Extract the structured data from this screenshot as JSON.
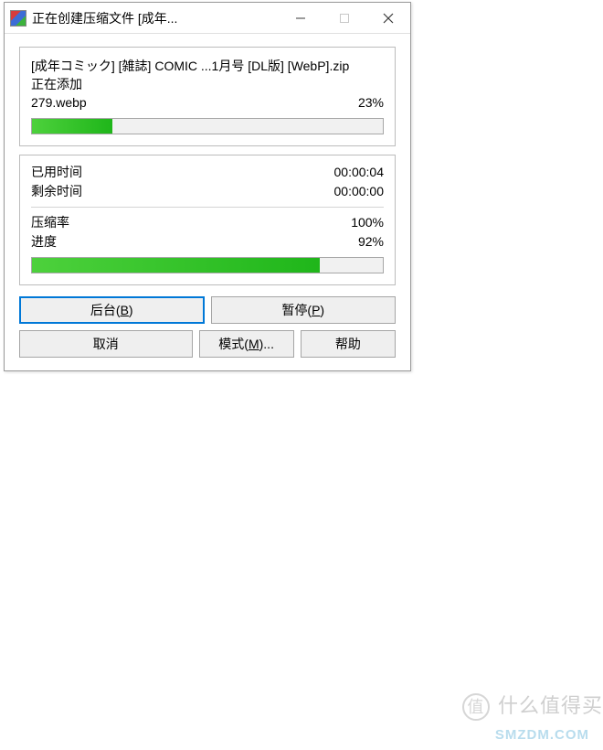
{
  "titlebar": {
    "title": "正在创建压缩文件 [成年..."
  },
  "file": {
    "name": "[成年コミック] [雑誌] COMIC ...1月号 [DL版] [WebP].zip",
    "status": "正在添加",
    "current_file": "279.webp",
    "file_percent": "23%",
    "file_progress": 23
  },
  "stats": {
    "elapsed_label": "已用时间",
    "elapsed_value": "00:00:04",
    "remaining_label": "剩余时间",
    "remaining_value": "00:00:00",
    "ratio_label": "压缩率",
    "ratio_value": "100%",
    "progress_label": "进度",
    "progress_value": "92%",
    "overall_progress": 82
  },
  "buttons": {
    "background": "后台(",
    "background_key": "B",
    "background_suffix": ")",
    "pause": "暂停(",
    "pause_key": "P",
    "pause_suffix": ")",
    "cancel": "取消",
    "mode": "模式(",
    "mode_key": "M",
    "mode_suffix": ")...",
    "help": "帮助"
  },
  "watermark": {
    "text1": "什么值得买",
    "text2": "SMZDM.COM"
  }
}
